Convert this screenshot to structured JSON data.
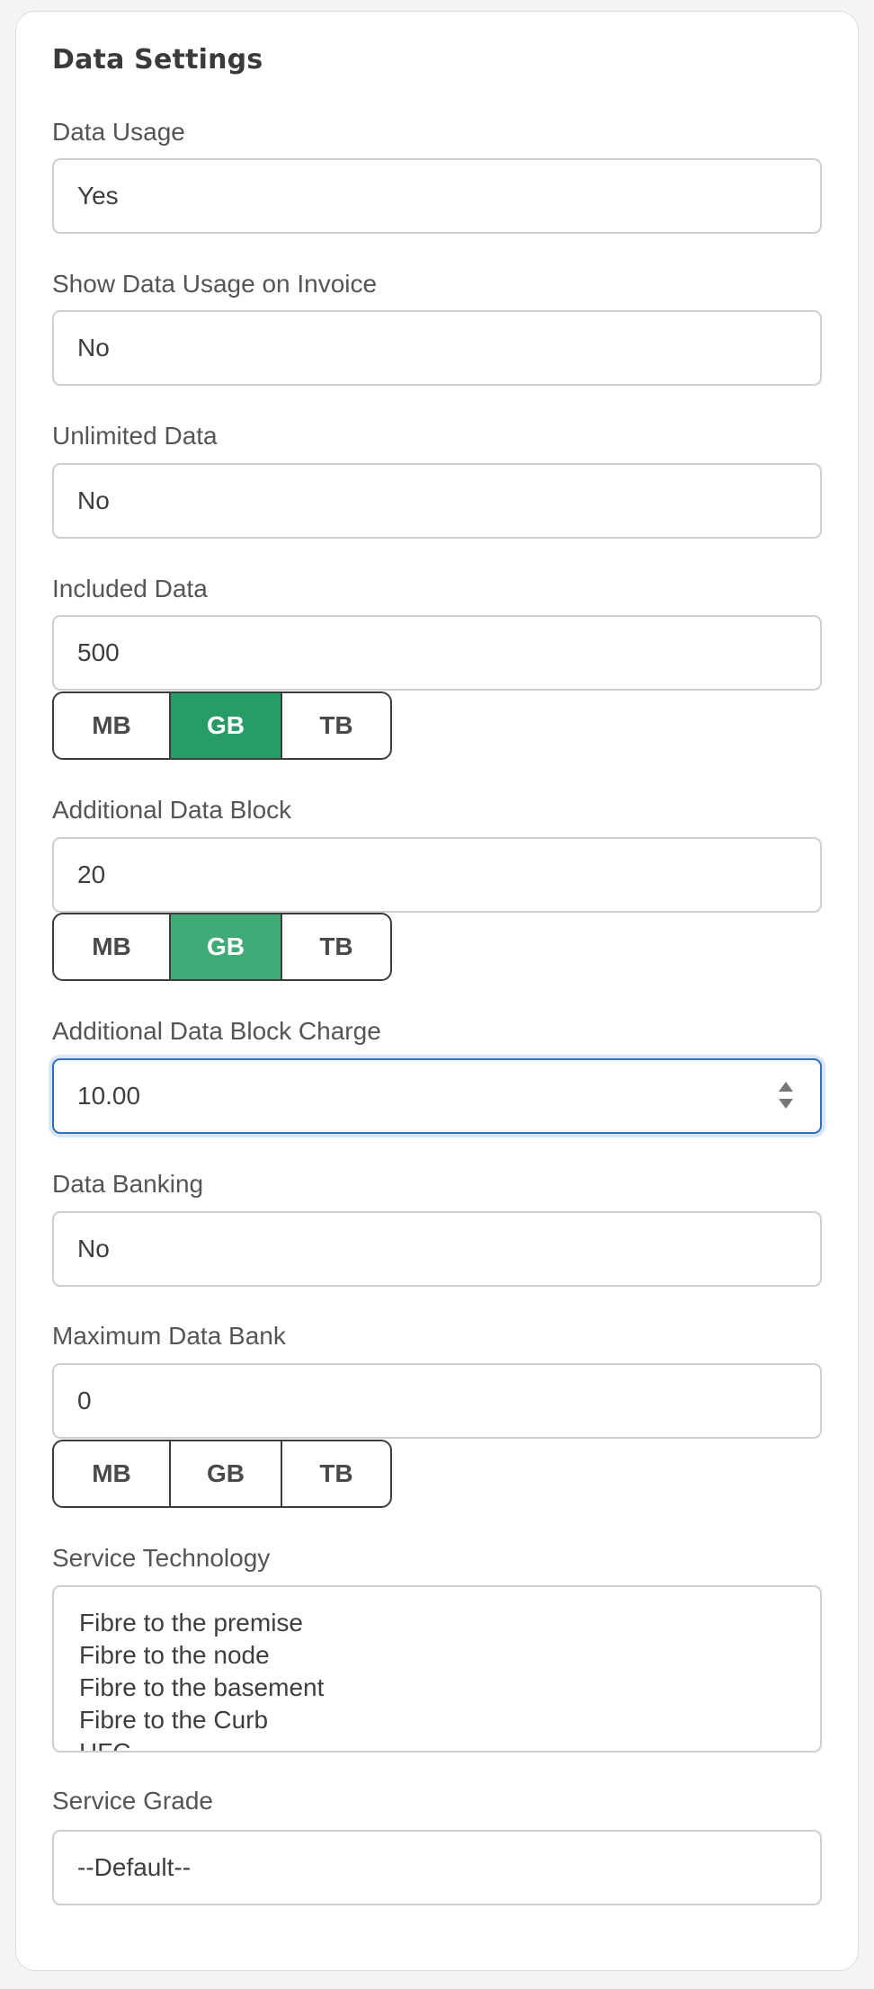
{
  "section": {
    "title": "Data Settings"
  },
  "fields": {
    "data_usage": {
      "label": "Data Usage",
      "value": "Yes"
    },
    "show_on_invoice": {
      "label": "Show Data Usage on Invoice",
      "value": "No"
    },
    "unlimited": {
      "label": "Unlimited Data",
      "value": "No"
    },
    "included": {
      "label": "Included Data",
      "value": "500"
    },
    "additional_block": {
      "label": "Additional Data Block",
      "value": "20"
    },
    "block_charge": {
      "label": "Additional Data Block Charge",
      "value": "10.00"
    },
    "banking": {
      "label": "Data Banking",
      "value": "No"
    },
    "max_bank": {
      "label": "Maximum Data Bank",
      "value": "0"
    },
    "technology": {
      "label": "Service Technology",
      "options": [
        "Fibre to the premise",
        "Fibre to the node",
        "Fibre to the basement",
        "Fibre to the Curb",
        "HFC"
      ]
    },
    "grade": {
      "label": "Service Grade",
      "value": "--Default--"
    }
  },
  "units": {
    "mb": "MB",
    "gb": "GB",
    "tb": "TB"
  },
  "selected_units": {
    "included": "GB",
    "additional_block": "GB",
    "max_bank": ""
  },
  "colors": {
    "active_unit": "#289c66",
    "active_unit_soft": "#3faa75",
    "focus_border": "#2f6fbf"
  }
}
